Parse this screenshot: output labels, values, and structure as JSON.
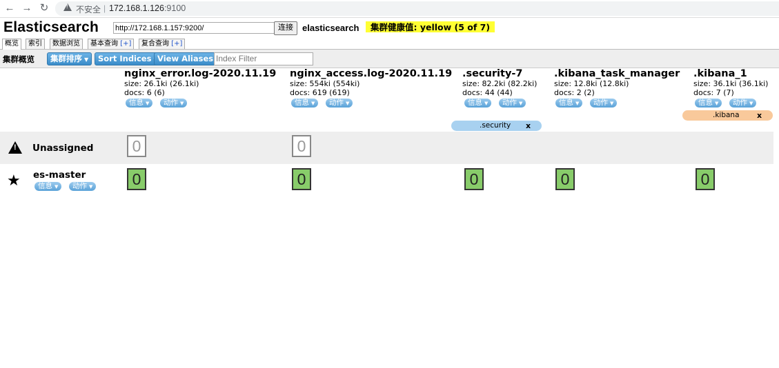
{
  "browser": {
    "back_icon": "arrow-left-icon",
    "forward_icon": "arrow-right-icon",
    "reload_icon": "reload-icon",
    "security_text": "不安全",
    "url_host": "172.168.1.126",
    "url_port": ":9100"
  },
  "header": {
    "title": "Elasticsearch",
    "connect_url": "http://172.168.1.157:9200/",
    "connect_label": "连接",
    "cluster_name": "elasticsearch",
    "health": "集群健康值: yellow (5 of 7)",
    "health_color": "#ffff33"
  },
  "tabs": [
    {
      "label": "概览",
      "plus": ""
    },
    {
      "label": "索引",
      "plus": ""
    },
    {
      "label": "数据浏览",
      "plus": ""
    },
    {
      "label": "基本查询 ",
      "plus": "[+]"
    },
    {
      "label": "复合查询 ",
      "plus": "[+]"
    }
  ],
  "toolbar": {
    "overview_label": "集群概览",
    "sort_cluster": "集群排序",
    "sort_indices": "Sort Indices",
    "view_aliases": "View Aliases",
    "filter_placeholder": "Index Filter"
  },
  "indices": [
    {
      "name": "nginx_error.log-2020.11.19",
      "size": "size: 26.1ki (26.1ki)",
      "docs": "docs: 6 (6)",
      "info": "信息",
      "action": "动作"
    },
    {
      "name": "nginx_access.log-2020.11.19",
      "size": "size: 554ki (554ki)",
      "docs": "docs: 619 (619)",
      "info": "信息",
      "action": "动作"
    },
    {
      "name": ".security-7",
      "size": "size: 82.2ki (82.2ki)",
      "docs": "docs: 44 (44)",
      "info": "信息",
      "action": "动作"
    },
    {
      "name": ".kibana_task_manager",
      "size": "size: 12.8ki (12.8ki)",
      "docs": "docs: 2 (2)",
      "info": "信息",
      "action": "动作"
    },
    {
      "name": ".kibana_1",
      "size": "size: 36.1ki (36.1ki)",
      "docs": "docs: 7 (7)",
      "info": "信息",
      "action": "动作"
    }
  ],
  "aliases": [
    {
      "name": ".security",
      "close": "x",
      "color": "#a8d1f0"
    },
    {
      "name": ".kibana",
      "close": "x",
      "color": "#f9c99b"
    }
  ],
  "rows": {
    "unassigned": {
      "label": "Unassigned",
      "icon": "warning-icon",
      "shards": [
        "0",
        "0"
      ]
    },
    "master": {
      "label": "es-master",
      "icon": "star-icon",
      "info": "信息",
      "action": "动作",
      "shards": [
        "0",
        "0",
        "0",
        "0",
        "0"
      ]
    }
  }
}
